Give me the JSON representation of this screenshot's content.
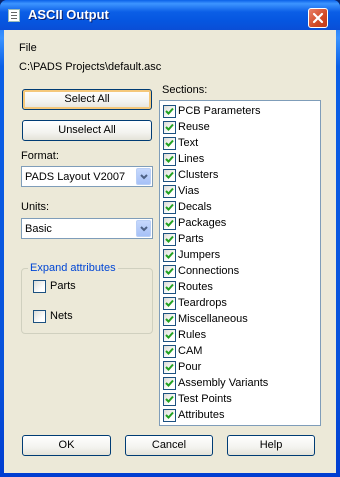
{
  "window": {
    "title": "ASCII Output"
  },
  "file": {
    "label": "File",
    "path": "C:\\PADS Projects\\default.asc"
  },
  "buttons": {
    "select_all": "Select All",
    "unselect_all": "Unselect All",
    "ok": "OK",
    "cancel": "Cancel",
    "help": "Help"
  },
  "format": {
    "label": "Format:",
    "value": "PADS Layout V2007"
  },
  "units": {
    "label": "Units:",
    "value": "Basic"
  },
  "expand": {
    "title": "Expand attributes",
    "parts": {
      "label": "Parts",
      "checked": false
    },
    "nets": {
      "label": "Nets",
      "checked": false
    }
  },
  "sections": {
    "label": "Sections:",
    "items": [
      {
        "label": "PCB Parameters",
        "checked": true
      },
      {
        "label": "Reuse",
        "checked": true
      },
      {
        "label": "Text",
        "checked": true
      },
      {
        "label": "Lines",
        "checked": true
      },
      {
        "label": "Clusters",
        "checked": true
      },
      {
        "label": "Vias",
        "checked": true
      },
      {
        "label": "Decals",
        "checked": true
      },
      {
        "label": "Packages",
        "checked": true
      },
      {
        "label": "Parts",
        "checked": true
      },
      {
        "label": "Jumpers",
        "checked": true
      },
      {
        "label": "Connections",
        "checked": true
      },
      {
        "label": "Routes",
        "checked": true
      },
      {
        "label": "Teardrops",
        "checked": true
      },
      {
        "label": "Miscellaneous",
        "checked": true
      },
      {
        "label": "Rules",
        "checked": true
      },
      {
        "label": "CAM",
        "checked": true
      },
      {
        "label": "Pour",
        "checked": true
      },
      {
        "label": "Assembly Variants",
        "checked": true
      },
      {
        "label": "Test Points",
        "checked": true
      },
      {
        "label": "Attributes",
        "checked": true
      }
    ]
  },
  "colors": {
    "titlebar": "#0a5fe6",
    "dialog_bg": "#ece9d8",
    "group_title": "#0046d5",
    "check": "#21a121"
  }
}
